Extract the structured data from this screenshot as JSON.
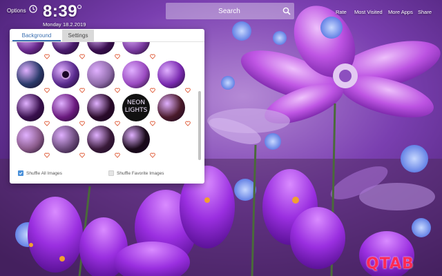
{
  "topbar": {
    "options_label": "Options",
    "time": "8:39",
    "day": "Monday",
    "date": "18.2.2019",
    "search_placeholder": "Search",
    "links": {
      "rate": "Rate",
      "most_visited": "Most Visited",
      "more_apps": "More Apps",
      "share": "Share"
    }
  },
  "panel": {
    "tabs": {
      "background": "Background",
      "settings": "Settings"
    },
    "active_tab": "Background",
    "options": {
      "shuffle_all": {
        "label": "Shuffle All Images",
        "checked": true
      },
      "shuffle_favorite": {
        "label": "Shuffle Favorite Images",
        "checked": false
      }
    },
    "thumbnail_rows": [
      [
        "purple dots",
        "purple bokeh",
        "purple flowers",
        "purple galaxy"
      ],
      [
        "blue planet",
        "purple eye",
        "glitter texture",
        "purple crystals",
        "purple sunset"
      ],
      [
        "purple stars",
        "purple swirl",
        "purple leaf",
        "neon lights",
        "purple glitter"
      ],
      [
        "purple petals",
        "water drops",
        "purple night",
        "purple flower"
      ]
    ],
    "neon_text": "NEON LIGHTS"
  },
  "logo": "QTAB",
  "colors": {
    "accent_blue": "#3a6fb0",
    "logo_red": "#ff2a55",
    "heart": "#e0613f"
  }
}
